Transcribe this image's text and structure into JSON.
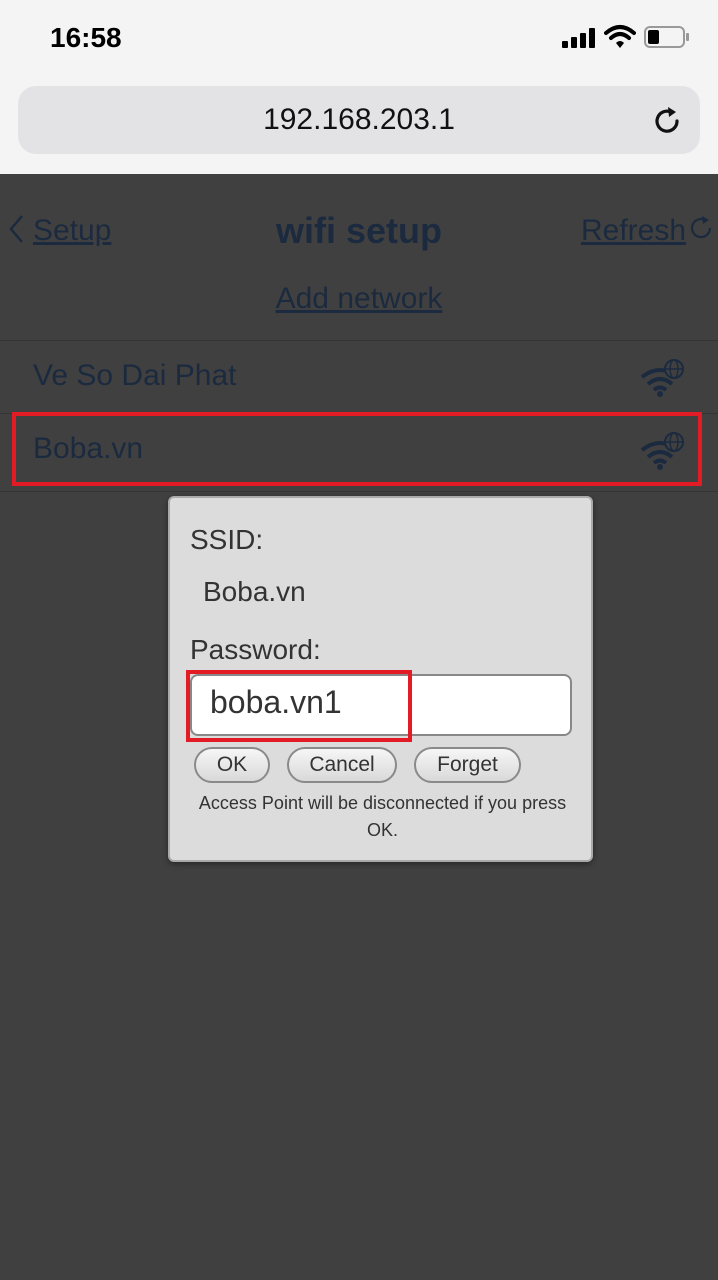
{
  "status_bar": {
    "time": "16:58",
    "icons": [
      "signal-icon",
      "wifi-icon",
      "battery-icon"
    ]
  },
  "browser": {
    "url": "192.168.203.1",
    "reload_icon": "reload-icon"
  },
  "page": {
    "back_label": "Setup",
    "title": "wifi setup",
    "refresh_label": "Refresh",
    "add_network_label": "Add network",
    "networks": [
      {
        "ssid": "Ve So Dai Phat",
        "icon": "wifi-globe-icon"
      },
      {
        "ssid": "Boba.vn",
        "icon": "wifi-globe-icon"
      }
    ]
  },
  "dialog": {
    "ssid_label": "SSID:",
    "ssid_value": "Boba.vn",
    "password_label": "Password:",
    "password_value": "boba.vn1",
    "ok_label": "OK",
    "cancel_label": "Cancel",
    "forget_label": "Forget",
    "note": "Access Point will be disconnected if you press OK."
  },
  "colors": {
    "highlight": "#e21b24",
    "link": "#1b2a3f",
    "overlay_background": "#404040"
  }
}
